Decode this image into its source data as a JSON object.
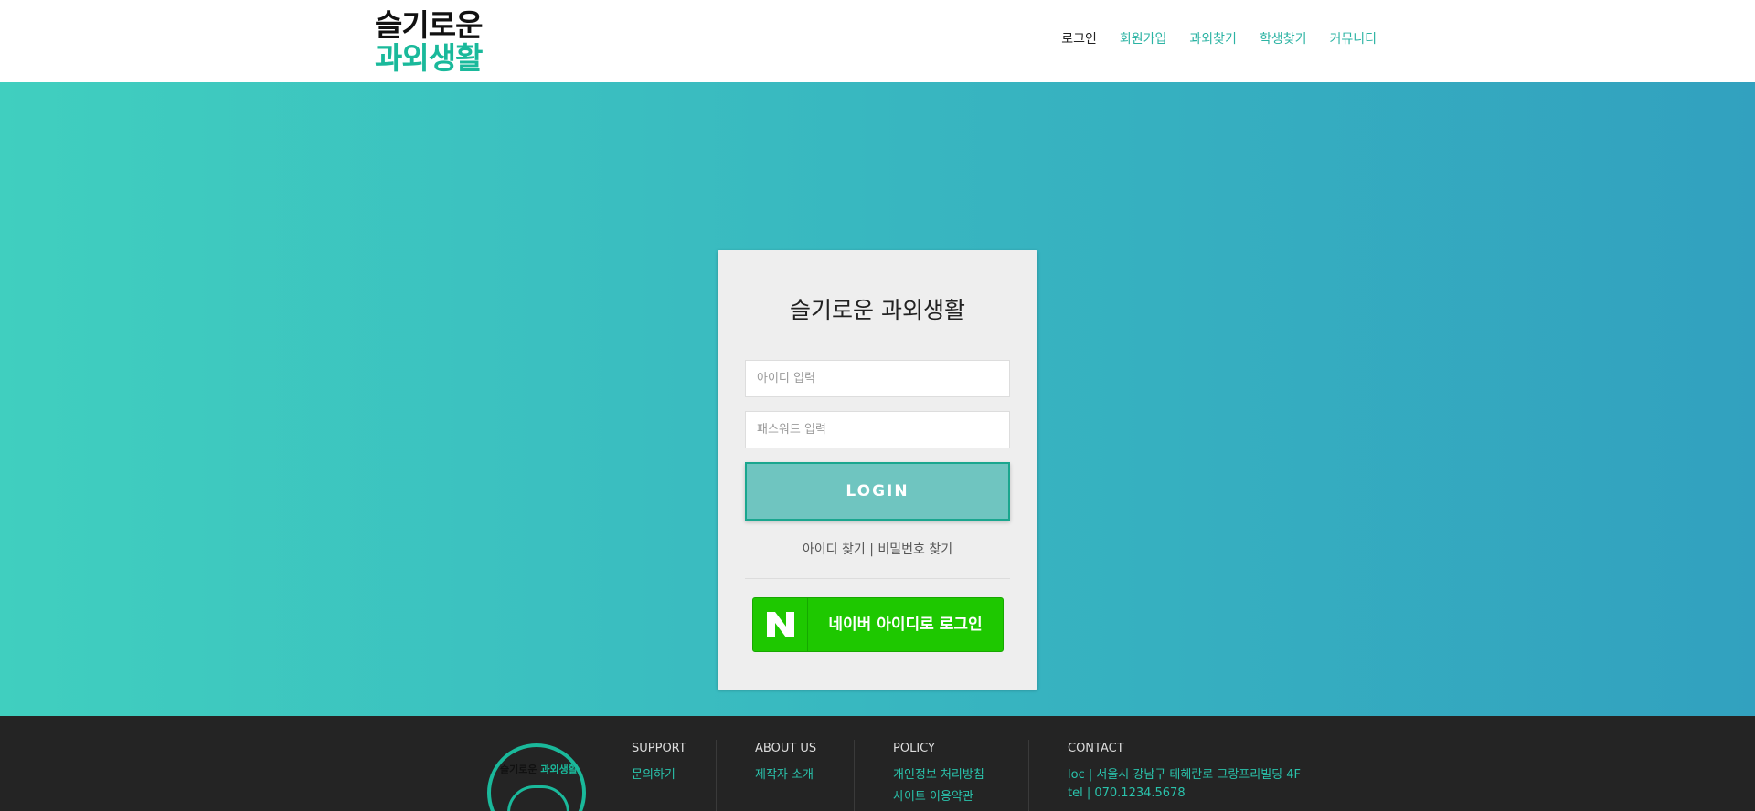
{
  "header": {
    "logo_line1": "슬기로운",
    "logo_line2": "과외생활",
    "nav": [
      "로그인",
      "회원가입",
      "과외찾기",
      "학생찾기",
      "커뮤니티"
    ]
  },
  "login": {
    "title": "슬기로운 과외생활",
    "id_placeholder": "아이디 입력",
    "pw_placeholder": "패스워드 입력",
    "login_label": "LOGIN",
    "find_id": "아이디 찾기",
    "find_sep": "|",
    "find_pw": "비밀번호 찾기",
    "naver_label": "네이버 아이디로 로그인"
  },
  "footer": {
    "emblem_text_a": "슬기로운",
    "emblem_text_b": "과외생활",
    "support": {
      "heading": "SUPPORT",
      "items": [
        "문의하기"
      ]
    },
    "about": {
      "heading": "ABOUT US",
      "items": [
        "제작자 소개"
      ]
    },
    "policy": {
      "heading": "POLICY",
      "items": [
        "개인정보 처리방침",
        "사이트 이용약관"
      ]
    },
    "contact": {
      "heading": "CONTACT",
      "loc": "loc  |  서울시 강남구 테헤란로 그랑프리빌딩 4F",
      "tel": "tel  |  070.1234.5678"
    }
  },
  "colors": {
    "accent": "#1ab99b",
    "naver": "#1ec800",
    "login_btn": "#6fc5c0"
  }
}
